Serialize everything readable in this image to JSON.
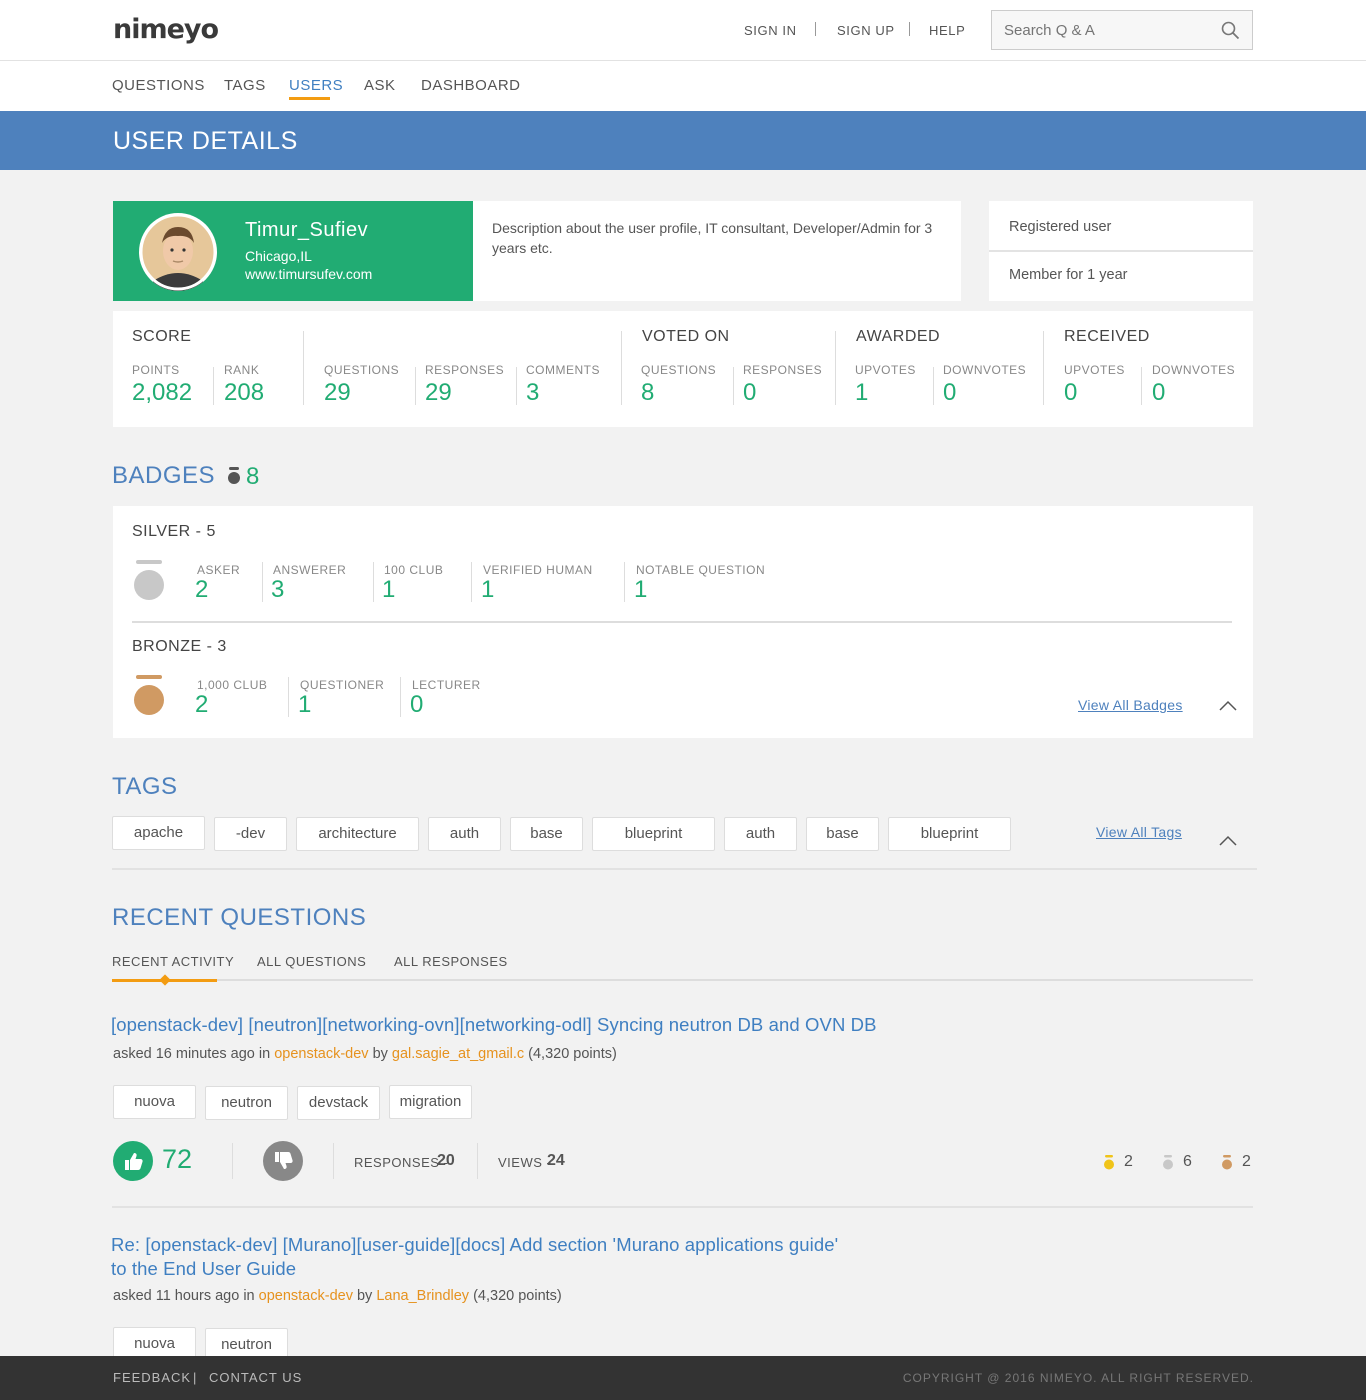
{
  "brand": {
    "logo": "nimeyo"
  },
  "header": {
    "sign_in": "SIGN IN",
    "sign_up": "SIGN UP",
    "help": "HELP",
    "search_placeholder": "Search Q & A"
  },
  "nav": [
    "QUESTIONS",
    "TAGS",
    "USERS",
    "ASK",
    "DASHBOARD"
  ],
  "page_title": "USER DETAILS",
  "user": {
    "name": "Timur_Sufiev",
    "location": "Chicago,IL",
    "website": "www.timursufev.com",
    "description": "Description about the user profile, IT consultant, Developer/Admin for 3 years etc.",
    "status": "Registered user",
    "membership": "Member for 1 year"
  },
  "stats": {
    "score": {
      "heading": "SCORE",
      "points_label": "POINTS",
      "points": "2,082",
      "rank_label": "RANK",
      "rank": "208"
    },
    "activity": {
      "questions_label": "QUESTIONS",
      "questions": "29",
      "responses_label": "RESPONSES",
      "responses": "29",
      "comments_label": "COMMENTS",
      "comments": "3"
    },
    "voted_on": {
      "heading": "VOTED ON",
      "questions_label": "QUESTIONS",
      "questions": "8",
      "responses_label": "RESPONSES",
      "responses": "0"
    },
    "awarded": {
      "heading": "AWARDED",
      "upvotes_label": "UPVOTES",
      "upvotes": "1",
      "downvotes_label": "DOWNVOTES",
      "downvotes": "0"
    },
    "received": {
      "heading": "RECEIVED",
      "upvotes_label": "UPVOTES",
      "upvotes": "0",
      "downvotes_label": "DOWNVOTES",
      "downvotes": "0"
    }
  },
  "badges": {
    "heading": "BADGES",
    "total": "8",
    "silver": {
      "heading": "SILVER - 5",
      "color": "#c8c8c8",
      "items": [
        {
          "label": "ASKER",
          "value": "2"
        },
        {
          "label": "ANSWERER",
          "value": "3"
        },
        {
          "label": "100 CLUB",
          "value": "1"
        },
        {
          "label": "VERIFIED HUMAN",
          "value": "1"
        },
        {
          "label": "NOTABLE QUESTION",
          "value": "1"
        }
      ]
    },
    "bronze": {
      "heading": "BRONZE - 3",
      "color": "#d09a63",
      "items": [
        {
          "label": "1,000 CLUB",
          "value": "2"
        },
        {
          "label": "QUESTIONER",
          "value": "1"
        },
        {
          "label": "LECTURER",
          "value": "0"
        }
      ]
    },
    "view_all": "View All Badges"
  },
  "tags": {
    "heading": "TAGS",
    "items": [
      "apache",
      "-dev",
      "architecture",
      "auth",
      "base",
      "blueprint",
      "auth",
      "base",
      "blueprint"
    ],
    "view_all": "View All Tags"
  },
  "recent": {
    "heading": "RECENT QUESTIONS",
    "tabs": [
      "RECENT ACTIVITY",
      "ALL QUESTIONS",
      "ALL RESPONSES"
    ],
    "questions": [
      {
        "title": "[openstack-dev] [neutron][networking-ovn][networking-odl] Syncing neutron DB and OVN DB",
        "asked": "asked 16 minutes ago in",
        "community": "openstack-dev",
        "by": "by",
        "author": "gal.sagie_at_gmail.c",
        "points": "(4,320 points)",
        "tags": [
          "nuova",
          "neutron",
          "devstack",
          "migration"
        ],
        "votes": "72",
        "responses_label": "RESPONSES -",
        "responses": "20",
        "views_label": "VIEWS -",
        "views": "24",
        "gold": "2",
        "silver": "6",
        "bronze": "2"
      },
      {
        "title_line1": "Re: [openstack-dev] [Murano][user-guide][docs] Add section 'Murano applications guide'",
        "title_line2": "to the End User Guide",
        "asked": "asked 11 hours ago in",
        "community": "openstack-dev",
        "by": "by",
        "author": "Lana_Brindley",
        "points": "(4,320 points)",
        "tags": [
          "nuova",
          "neutron"
        ]
      }
    ]
  },
  "footer": {
    "feedback": "FEEDBACK",
    "separator": "|",
    "contact": "CONTACT US",
    "copyright": "COPYRIGHT @ 2016 NIMEYO. ALL RIGHT RESERVED."
  },
  "colors": {
    "accent_blue": "#4e81bd",
    "accent_green": "#21ac73",
    "accent_orange": "#f39c12",
    "gold": "#f0c419",
    "silver": "#c8c8c8",
    "bronze": "#d09a63"
  }
}
